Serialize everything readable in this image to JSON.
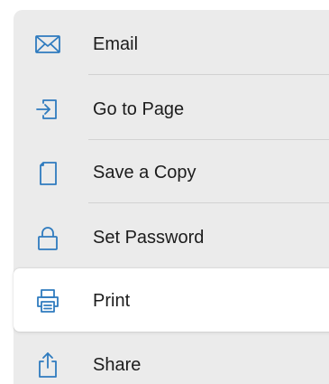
{
  "accent_color": "#2f7bbf",
  "menu": {
    "items": [
      {
        "label": "Email",
        "icon": "envelope-icon"
      },
      {
        "label": "Go to Page",
        "icon": "go-to-page-icon"
      },
      {
        "label": "Save a Copy",
        "icon": "document-copy-icon"
      },
      {
        "label": "Set Password",
        "icon": "lock-icon"
      },
      {
        "label": "Print",
        "icon": "printer-icon",
        "selected": true
      },
      {
        "label": "Share",
        "icon": "share-icon"
      }
    ]
  }
}
